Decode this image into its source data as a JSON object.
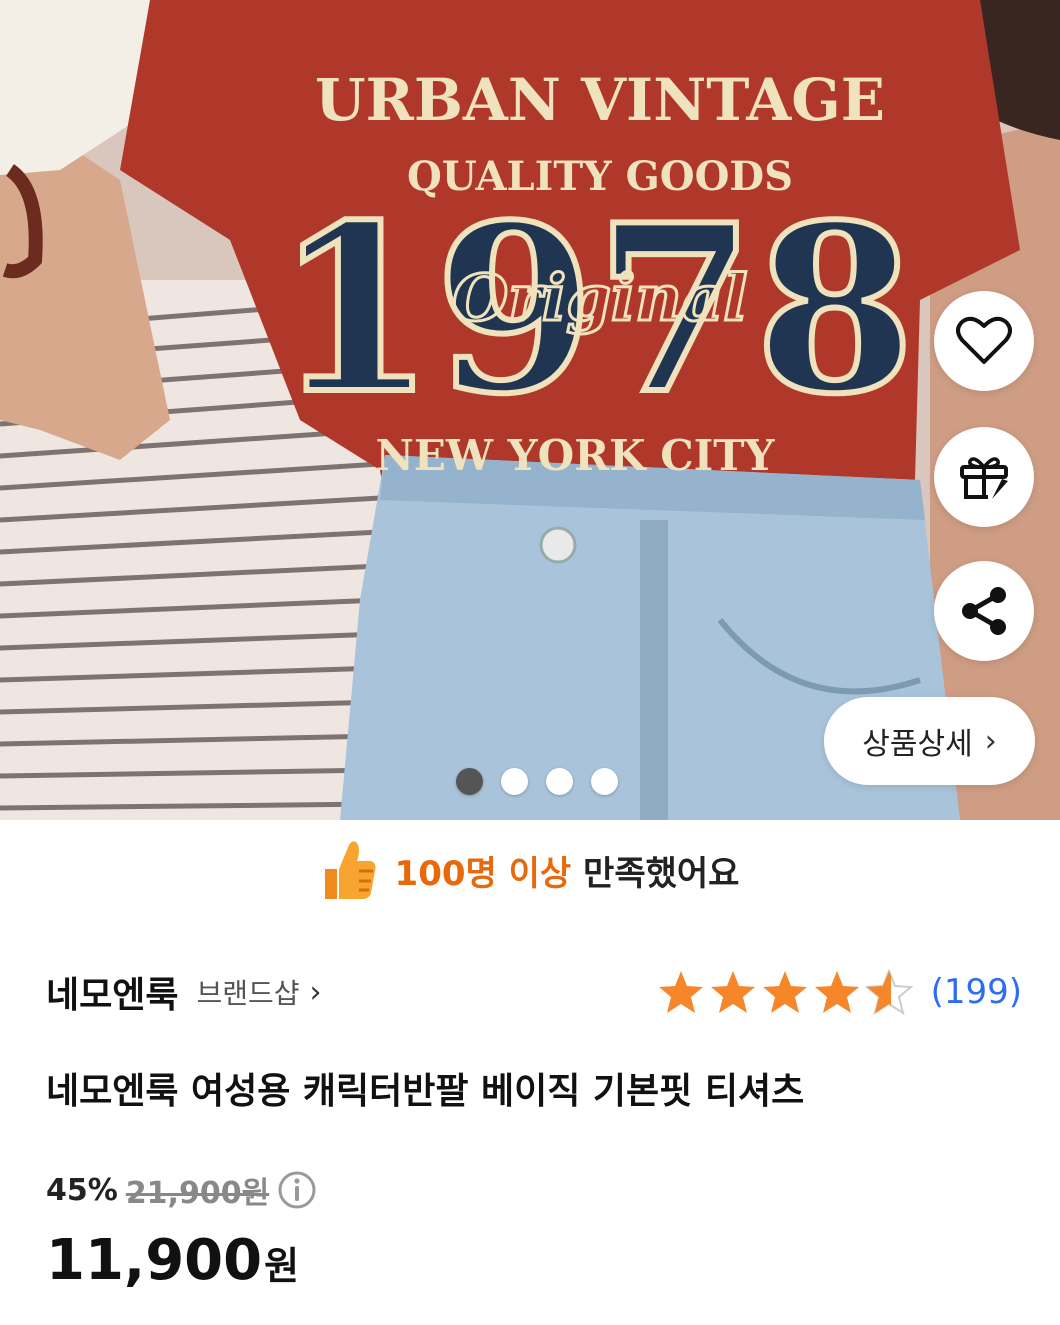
{
  "hero": {
    "shirt_print": {
      "line1": "URBAN VINTAGE",
      "line2": "QUALITY GOODS",
      "number": "1978",
      "script": "Original",
      "line3": "NEW YORK CITY"
    },
    "detail_label": "상품상세",
    "detail_chevron": "›",
    "carousel": {
      "count": 4,
      "active": 0
    },
    "colors": {
      "shirt": "#b0382a",
      "print_navy": "#1f3552",
      "print_cream": "#efe2bd",
      "denim": "#a9c4da"
    }
  },
  "satisfaction": {
    "highlight": "100명 이상",
    "rest": "만족했어요",
    "accent_color": "#e8680c"
  },
  "brand": {
    "name": "네모엔룩",
    "shop_label": "브랜드샵",
    "chevron": "›"
  },
  "rating": {
    "score": 4.5,
    "max": 5,
    "review_count": "(199)",
    "star_color": "#f5872a",
    "link_color": "#2d6df6"
  },
  "product": {
    "title": "네모엔룩 여성용 캐릭터반팔 베이직 기본핏 티셔츠"
  },
  "price": {
    "discount": "45%",
    "original": "21,900원",
    "current": "11,900",
    "currency": "원"
  }
}
